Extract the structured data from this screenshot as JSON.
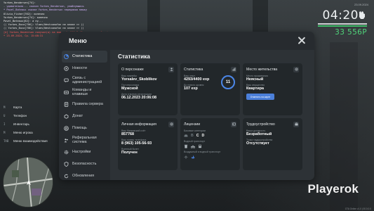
{
  "hud": {
    "clock": "04:20",
    "money": "33 556P",
    "top_info": "23.09.2024",
    "build": "GTA Online v1.0 | 00.0.0.0"
  },
  "chat": [
    {
      "text": "Yorkes_Hendersen[74]:",
      "color": "#f1f1f1"
    },
    {
      "text": "- удивительно... сказал Yorkes_Henderson, улыбнувшись",
      "color": "#d6b5ff"
    },
    {
      "text": "* Pavel_Bateaux сказал Yorkes_Henderson передавая мешку",
      "color": "#d6b5ff"
    },
    {
      "text": "Olivia_Fisher[762]: конечно",
      "color": "#f1f1f1"
    },
    {
      "text": "Yorkes_Hendersen[74]: конечно",
      "color": "#f1f1f1"
    },
    {
      "text": "Pavel_Bateaux[62]: а ну...",
      "color": "#f1f1f1"
    },
    {
      "text": "(( Yorkes_Buca[706]: Vlaev/Westcomofon на клике >> ))",
      "color": "#e8e8e8"
    },
    {
      "text": "(( Yorkes_Buca[706]: Vlaev/Westcomofon на клике >> ))",
      "color": "#e8e8e8"
    },
    {
      "text": "[A] Yorkes_Henderson получил(а) на ваш счёт 500 Р (Выплата по работе)",
      "color": "#ff5a5a"
    },
    {
      "text": "* 23.09.2024, Ср. 15:08:31",
      "color": "#ff5a5a"
    }
  ],
  "hotkeys": [
    {
      "key": "M",
      "label": "Карта"
    },
    {
      "key": "U",
      "label": "Телефон"
    },
    {
      "key": "I",
      "label": "Инвентарь"
    },
    {
      "key": "M",
      "label": "Меню игрока"
    },
    {
      "key": "TAB",
      "label": "Меню взаимодействия"
    }
  ],
  "watermark": "Playerok",
  "menu": {
    "title": "Меню",
    "content_title": "Статистика",
    "nav": [
      {
        "label": "Статистика",
        "icon": "stats-icon",
        "active": true
      },
      {
        "label": "Новости",
        "icon": "news-icon",
        "active": false
      },
      {
        "label": "Связь с администрацией",
        "icon": "support-icon",
        "active": false
      },
      {
        "label": "Команды и клавиши",
        "icon": "keyboard-icon",
        "active": false
      },
      {
        "label": "Правила сервера",
        "icon": "rules-icon",
        "active": false
      },
      {
        "label": "Донат",
        "icon": "donate-icon",
        "active": false
      },
      {
        "label": "Помощь",
        "icon": "help-icon",
        "active": false
      },
      {
        "label": "Реферальная система",
        "icon": "referral-icon",
        "active": false
      },
      {
        "label": "Настройки",
        "icon": "settings-icon",
        "active": false
      },
      {
        "label": "Безопасность",
        "icon": "security-icon",
        "active": false
      },
      {
        "label": "Обновления",
        "icon": "updates-icon",
        "active": false
      }
    ],
    "cards": {
      "person": {
        "title": "О персонаже",
        "name_label": "Ваш никнейм",
        "name": "Yorsalev_Skoblikov",
        "gender_label": "Пол персонажа",
        "gender": "Мужской",
        "reg_label": "Дата и время регистрации",
        "reg": "06.12.2023 20:06:08"
      },
      "stats": {
        "title": "Статистика",
        "exp_label": "Ваш опыт",
        "exp": "4293/4400 exp",
        "next_label": "До нового уровня",
        "next": "107 exp",
        "level": "11",
        "level_progress": 0.976
      },
      "residence": {
        "title": "Место жительства",
        "place_label": "Место проживания",
        "place": "Неясный",
        "property_label": "Ваш имущество",
        "property": "Квартира",
        "button": "Отметить на карте"
      },
      "personal": {
        "title": "Личная информация",
        "bank_label": "Ваш банковский счёт",
        "bank": "857768",
        "phone_label": "Ваш номер телефона",
        "phone": "8 (963) 105-56-93",
        "military_label": "Военный билет",
        "military": "Получен"
      },
      "licenses": {
        "title": "Лицензии",
        "basic_label": "Базовые категории",
        "categories": [
          "B",
          "C",
          "D"
        ],
        "water_label": "Водный транспорт",
        "air_label": "Воздушный и водный транспорт"
      },
      "employment": {
        "title": "Трудоустройство",
        "job_label": "Ваша должность",
        "job": "Безработный",
        "prev_label": "Точка трудоустройства",
        "prev": "Отсутствует"
      }
    }
  }
}
